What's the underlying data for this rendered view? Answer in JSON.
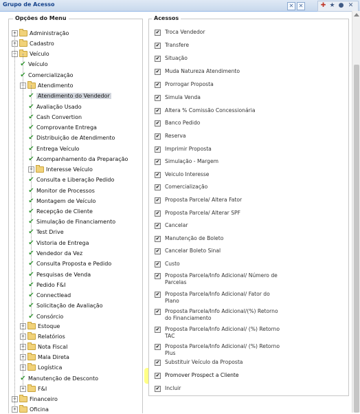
{
  "window": {
    "title": "Grupo de Acesso",
    "controls": [
      "window-pin-icon",
      "window-close-icon",
      "add-icon",
      "star-icon",
      "cancel-icon"
    ]
  },
  "menu": {
    "legend": "Opções do Menu",
    "items": [
      {
        "label": "Administração",
        "type": "folder",
        "expander": "+"
      },
      {
        "label": "Cadastro",
        "type": "folder",
        "expander": "+"
      },
      {
        "label": "Veículo",
        "type": "folder",
        "expander": "−"
      },
      {
        "label": "Veículo",
        "type": "check"
      },
      {
        "label": "Comercialização",
        "type": "check"
      },
      {
        "label": "Atendimento",
        "type": "folder",
        "expander": "−"
      },
      {
        "label": "Atendimento do Vendedor",
        "type": "check",
        "selected": true
      },
      {
        "label": "Avaliação Usado",
        "type": "check"
      },
      {
        "label": "Cash Convertion",
        "type": "check"
      },
      {
        "label": "Comprovante Entrega",
        "type": "check"
      },
      {
        "label": "Distribuição de Atendimento",
        "type": "check"
      },
      {
        "label": "Entrega Veículo",
        "type": "check"
      },
      {
        "label": "Acompanhamento da Preparação",
        "type": "check"
      },
      {
        "label": "Interesse Veículo",
        "type": "folder",
        "expander": "+"
      },
      {
        "label": "Consulta e Liberação Pedido",
        "type": "check"
      },
      {
        "label": "Monitor de Processos",
        "type": "check"
      },
      {
        "label": "Montagem de Veículo",
        "type": "check"
      },
      {
        "label": "Recepção de Cliente",
        "type": "check"
      },
      {
        "label": "Simulação de Financiamento",
        "type": "check"
      },
      {
        "label": "Test Drive",
        "type": "check"
      },
      {
        "label": "Vistoria de Entrega",
        "type": "check"
      },
      {
        "label": "Vendedor da Vez",
        "type": "check"
      },
      {
        "label": "Consulta Proposta e Pedido",
        "type": "check"
      },
      {
        "label": "Pesquisas de Venda",
        "type": "check"
      },
      {
        "label": "Pedido F&I",
        "type": "check"
      },
      {
        "label": "Connectlead",
        "type": "check"
      },
      {
        "label": "Solicitação de Avaliação",
        "type": "check"
      },
      {
        "label": "Consórcio",
        "type": "check"
      },
      {
        "label": "Estoque",
        "type": "folder",
        "expander": "+"
      },
      {
        "label": "Relatórios",
        "type": "folder",
        "expander": "+"
      },
      {
        "label": "Nota Fiscal",
        "type": "folder",
        "expander": "+"
      },
      {
        "label": "Mala Direta",
        "type": "folder",
        "expander": "+"
      },
      {
        "label": "Logística",
        "type": "folder",
        "expander": "+"
      },
      {
        "label": "Manutenção de Desconto",
        "type": "check"
      },
      {
        "label": "F&I",
        "type": "folder",
        "expander": "+"
      },
      {
        "label": "Financeiro",
        "type": "folder",
        "expander": "+"
      },
      {
        "label": "Oficina",
        "type": "folder",
        "expander": "+"
      }
    ]
  },
  "access": {
    "legend": "Acessos",
    "items": [
      {
        "label": "Troca Vendedor",
        "checked": true
      },
      {
        "label": "Transfere",
        "checked": true
      },
      {
        "label": "Situação",
        "checked": true
      },
      {
        "label": "Muda Natureza Atendimento",
        "checked": true
      },
      {
        "label": "Prorrogar Proposta",
        "checked": true
      },
      {
        "label": "Simula Venda",
        "checked": true
      },
      {
        "label": "Altera % Comissão Concessionária",
        "checked": true
      },
      {
        "label": "Banco Pedido",
        "checked": true
      },
      {
        "label": "Reserva",
        "checked": true
      },
      {
        "label": "Imprimir Proposta",
        "checked": true
      },
      {
        "label": "Simulação - Margem",
        "checked": true
      },
      {
        "label": "Veiculo Interesse",
        "checked": true
      },
      {
        "label": "Comercialização",
        "checked": true
      },
      {
        "label": "Proposta Parcela/ Altera Fator",
        "checked": true
      },
      {
        "label": "Proposta Parcela/ Alterar SPF",
        "checked": true
      },
      {
        "label": "Cancelar",
        "checked": true
      },
      {
        "label": "Manutenção de Boleto",
        "checked": true
      },
      {
        "label": "Cancelar Boleto Sinal",
        "checked": true
      },
      {
        "label": "Custo",
        "checked": true
      },
      {
        "label": "Proposta Parcela/Info Adicional/ Número de Parcelas",
        "checked": true
      },
      {
        "label": "Proposta Parcela/Info Adicional/ Fator do Plano",
        "checked": true
      },
      {
        "label": "Proposta Parcela/Info Adicional/(%) Retorno do Financiamento",
        "checked": true
      },
      {
        "label": "Proposta Parcela/Info Adicional/ (%) Retorno TAC",
        "checked": true
      },
      {
        "label": "Proposta Parcela/Info Adicional/ (%) Retorno Plus",
        "checked": true
      },
      {
        "label": "Substituir Veículo da Proposta",
        "checked": true
      },
      {
        "label": "Promover Prospect a Cliente",
        "checked": true,
        "highlighted": true
      },
      {
        "label": "Incluir",
        "checked": true
      }
    ]
  },
  "colors": {
    "check": "#2f9a2f",
    "highlight": "#ffff85",
    "title": "#15428b"
  }
}
